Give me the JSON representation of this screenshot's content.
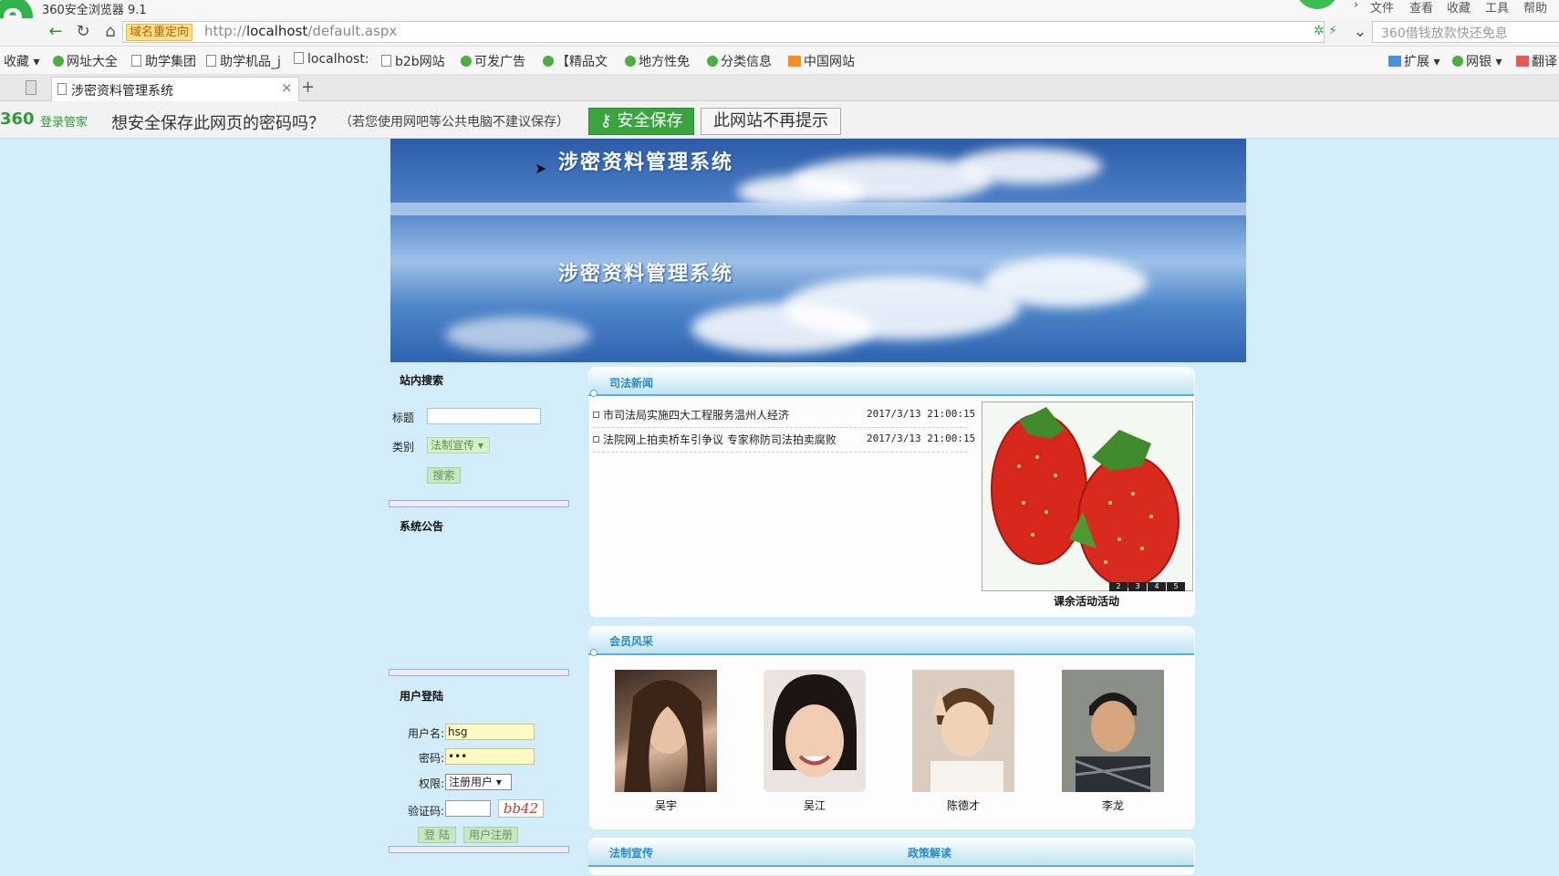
{
  "browser": {
    "title": "360安全浏览器 9.1",
    "menu": [
      "文件",
      "查看",
      "收藏",
      "工具",
      "帮助"
    ],
    "redirect_badge": "域名重定向",
    "url_prefix": "http://",
    "url_host": "localhost",
    "url_path": "/default.aspx",
    "search_placeholder": "360借钱放款快还免息",
    "bookmarks": [
      "收藏",
      "网址大全",
      "助学集团",
      "助学机品_j",
      "localhost:",
      "b2b网站",
      "可发广告",
      "【精品文",
      "地方性免",
      "分类信息",
      "中国网站"
    ],
    "right_tools": [
      "扩展",
      "网银",
      "翻译"
    ],
    "tab_title": "涉密资料管理系统",
    "notify": {
      "brand": "360",
      "brand_sub": "登录管家",
      "question": "想安全保存此网页的密码吗？",
      "hint": "（若您使用网吧等公共电脑不建议保存）",
      "save_btn": "安全保存",
      "never_btn": "此网站不再提示"
    }
  },
  "banner": {
    "title1": "涉密资料管理系统",
    "title2": "涉密资料管理系统"
  },
  "search": {
    "heading": "站内搜索",
    "title_label": "标题",
    "category_label": "类别",
    "category_value": "法制宣传",
    "search_btn": "搜索"
  },
  "notice": {
    "heading": "系统公告"
  },
  "login": {
    "heading": "用户登陆",
    "username_label": "用户名:",
    "username_value": "hsg",
    "password_label": "密码:",
    "password_value": "•••",
    "role_label": "权限:",
    "role_value": "注册用户",
    "captcha_label": "验证码:",
    "captcha_text": "bb42",
    "login_btn": "登 陆",
    "register_btn": "用户注册"
  },
  "news": {
    "heading": "司法新闻",
    "items": [
      {
        "title": "市司法局实施四大工程服务温州人经济",
        "date": "2017/3/13 21:00:15"
      },
      {
        "title": "法院网上拍卖桥车引争议 专家称防司法拍卖腐败",
        "date": "2017/3/13 21:00:15"
      }
    ],
    "photo_caption": "课余活动活动",
    "pager": [
      "2",
      "3",
      "4",
      "5"
    ]
  },
  "members": {
    "heading": "会员风采",
    "people": [
      {
        "name": "吴宇"
      },
      {
        "name": "吴江"
      },
      {
        "name": "陈德才"
      },
      {
        "name": "李龙"
      }
    ]
  },
  "bottom": {
    "left_heading": "法制宣传",
    "right_heading": "政策解读"
  }
}
